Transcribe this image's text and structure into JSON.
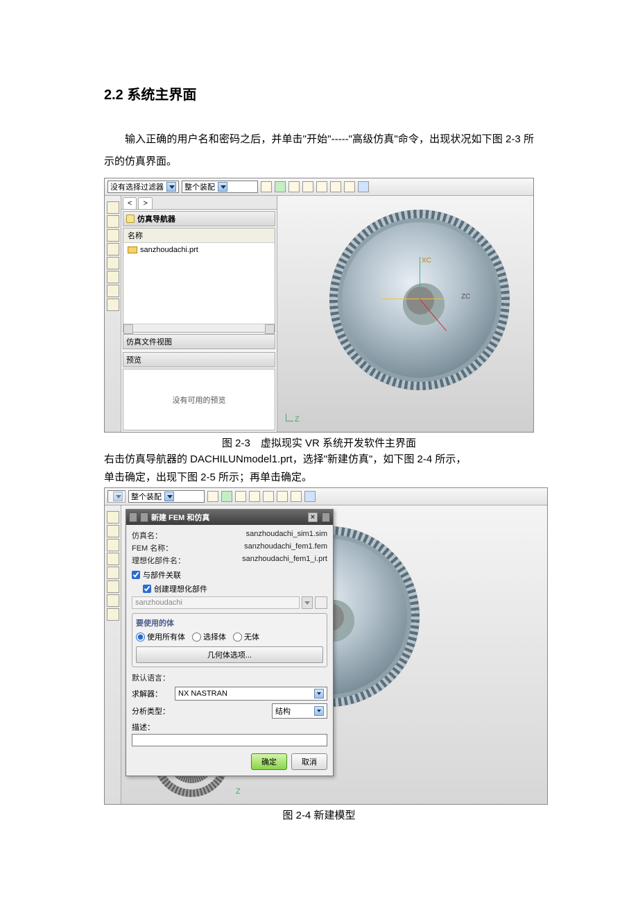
{
  "heading": "2.2  系统主界面",
  "para1": "输入正确的用户名和密码之后，并单击\"开始\"-----\"高级仿真\"命令，出现状况如下图 2-3 所示的仿真界面。",
  "caption1": "图 2-3　虚拟现实 VR 系统开发软件主界面",
  "para2a": "右击仿真导航器的 DACHILUNmodel1.prt，选择\"新建仿真\"，如下图 2-4 所示，",
  "para2b": "单击确定，出现下图 2-5 所示；再单击确定。",
  "caption2": "图 2-4 新建模型",
  "shotA": {
    "filter_combo": "没有选择过滤器",
    "assembly_combo": "整个装配",
    "nav_title": "仿真导航器",
    "col_name": "名称",
    "file_item": "sanzhoudachi.prt",
    "fileview_title": "仿真文件视图",
    "preview_title": "预览",
    "preview_empty": "没有可用的预览",
    "axis_z": "Z",
    "axis_zc": "ZC",
    "axis_xc": "XC"
  },
  "shotB": {
    "assembly_combo": "整个装配",
    "dialog_title": "新建 FEM 和仿真",
    "row_sim_label": "仿真名：",
    "row_sim_value": "sanzhoudachi_sim1.sim",
    "row_fem_label": "FEM 名称：",
    "row_fem_value": "sanzhoudachi_fem1.fem",
    "row_ideal_label": "理想化部件名：",
    "row_ideal_value": "sanzhoudachi_fem1_i.prt",
    "chk_assoc": "与部件关联",
    "chk_create_ideal": "创建理想化部件",
    "disabled_field": "sanzhoudachi",
    "group_body_title": "要使用的体",
    "radio_all": "使用所有体",
    "radio_select": "选择体",
    "radio_none": "无体",
    "geom_btn": "几何体选项...",
    "lang_label": "默认语言：",
    "solver_label": "求解器：",
    "solver_value": "NX NASTRAN",
    "analysis_label": "分析类型：",
    "analysis_value": "结构",
    "desc_label": "描述：",
    "btn_ok": "确定",
    "btn_cancel": "取消",
    "axis_z": "Z"
  }
}
